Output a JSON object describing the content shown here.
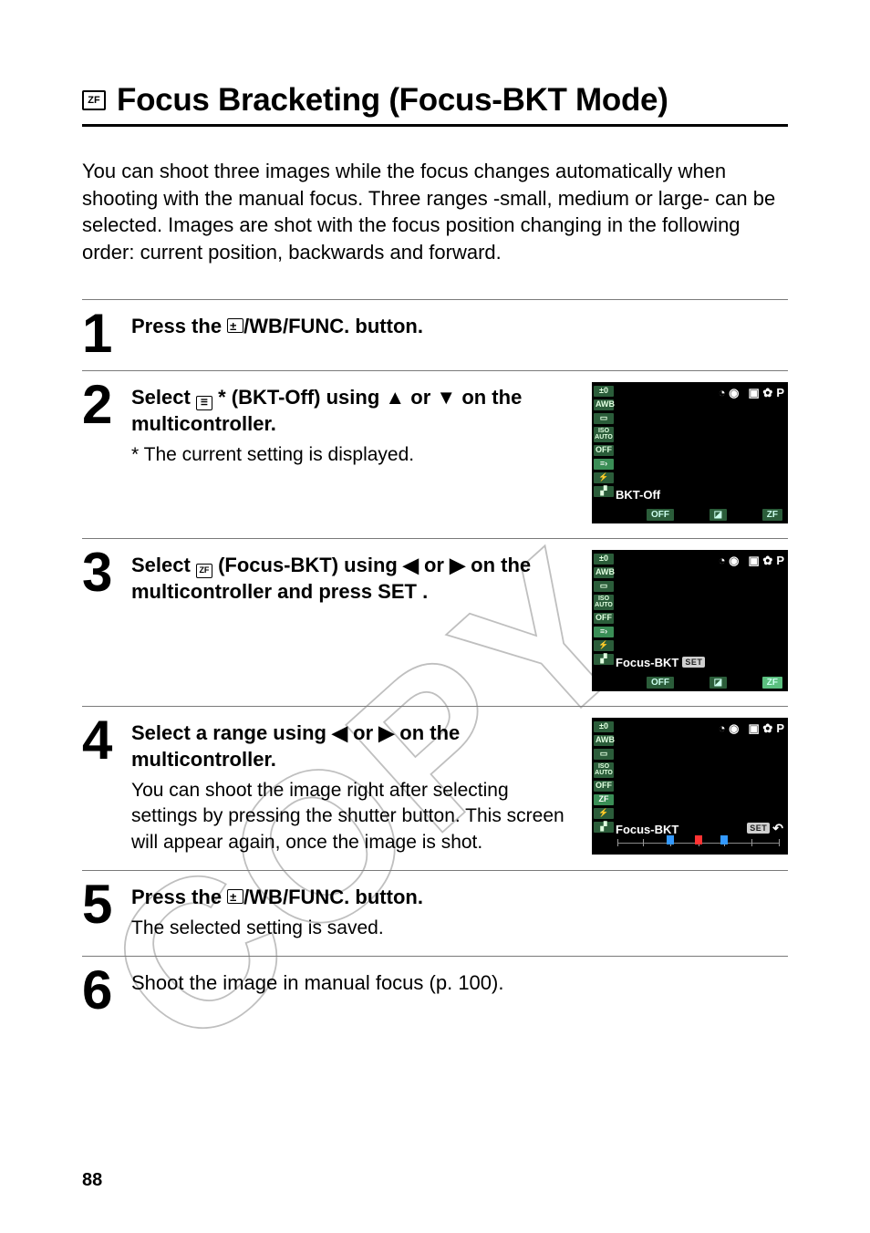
{
  "page_number": "88",
  "title": {
    "icon_label": "ZF",
    "text": "Focus Bracketing (Focus-BKT Mode)"
  },
  "intro": "You can shoot three images while the focus changes automatically when shooting with the manual focus. Three ranges -small, medium or large- can be selected. Images are shot with the focus position changing in the following order: current position, backwards and forward.",
  "common": {
    "wb": "WB",
    "func": "FUNC.",
    "set": "SET",
    "p": "P",
    "press_the": "Press the ",
    "select": "Select ",
    "button": " button.",
    "slash": " / "
  },
  "steps": [
    {
      "num": "1",
      "parts": {
        "after": " button."
      }
    },
    {
      "num": "2",
      "parts": {
        "icon_name": "bkt-off-icon",
        "after_icon": "* (BKT-Off) using ",
        "tail": " on the multicontroller.",
        "or": " or ",
        "sub": "* The current setting is displayed."
      },
      "screen": {
        "label": "BKT-Off",
        "ev": "±0",
        "awb": "AWB",
        "iso": "ISO\nAUTO",
        "off": "OFF"
      }
    },
    {
      "num": "3",
      "parts": {
        "icon_name": "focus-bkt-icon",
        "after_icon": " (Focus-BKT) using ",
        "or": " or ",
        "tail": " on the multicontroller and press ",
        "end": "."
      },
      "screen": {
        "label": "Focus-BKT",
        "set": "SET",
        "ev": "±0",
        "awb": "AWB",
        "iso": "ISO\nAUTO",
        "off": "OFF"
      }
    },
    {
      "num": "4",
      "parts": {
        "before": "Select a range using ",
        "or": " or ",
        "tail": " on the multicontroller.",
        "sub": "You can shoot the image right after selecting settings by pressing the shutter button.  This screen will appear again, once the image is shot."
      },
      "screen": {
        "label": "Focus-BKT",
        "set": "SET",
        "ev": "±0",
        "awb": "AWB",
        "iso": "ISO\nAUTO",
        "off": "OFF"
      }
    },
    {
      "num": "5",
      "parts": {
        "sub": "The selected setting is saved."
      }
    },
    {
      "num": "6",
      "parts": {
        "text": "Shoot the image in manual focus (p. 100)."
      }
    }
  ]
}
